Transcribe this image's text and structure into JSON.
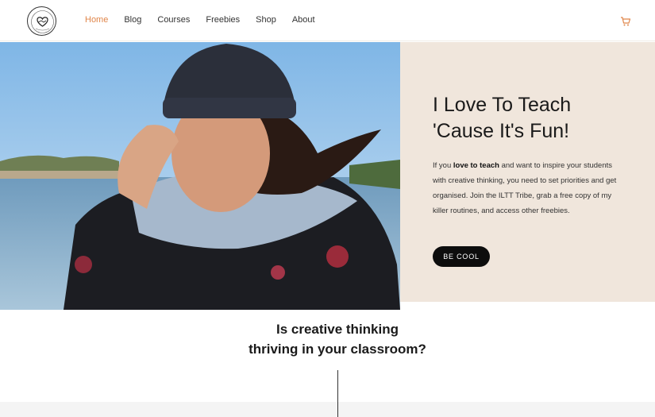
{
  "header": {
    "logo_alt": "I Love to Teach",
    "nav": [
      {
        "label": "Home",
        "active": true
      },
      {
        "label": "Blog",
        "active": false
      },
      {
        "label": "Courses",
        "active": false
      },
      {
        "label": "Freebies",
        "active": false
      },
      {
        "label": "Shop",
        "active": false
      },
      {
        "label": "About",
        "active": false
      }
    ],
    "cart_icon": "shopping-cart-icon"
  },
  "hero": {
    "title_line1": "I Love To Teach",
    "title_line2": "'Cause It's Fun!",
    "body_pre": "If you ",
    "body_bold": "love to teach",
    "body_post": " and want to inspire your students with creative thinking, you need to set priorities and get organised. Join the ILTT Tribe, grab a free copy of my killer routines, and access other freebies.",
    "cta_label": "BE COOL"
  },
  "section": {
    "question_line1": "Is creative thinking",
    "question_line2": "thriving in your classroom?"
  },
  "colors": {
    "accent": "#e0864a",
    "panel_bg": "#f0e6dc",
    "button_bg": "#0d0d0d"
  }
}
